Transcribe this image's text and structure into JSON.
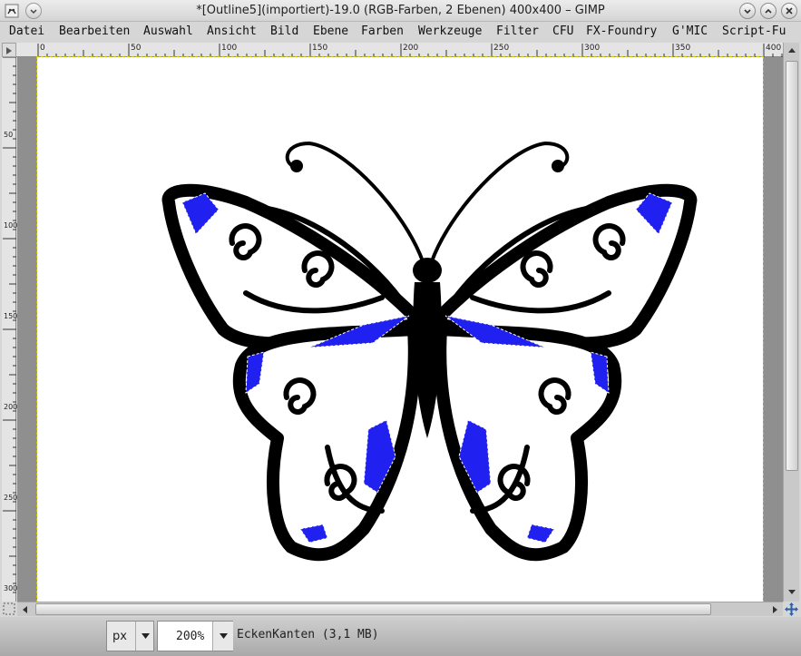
{
  "window": {
    "title": "*[Outline5](importiert)-19.0 (RGB-Farben, 2 Ebenen) 400x400 – GIMP"
  },
  "menubar": {
    "items": [
      {
        "label": "Datei"
      },
      {
        "label": "Bearbeiten"
      },
      {
        "label": "Auswahl"
      },
      {
        "label": "Ansicht"
      },
      {
        "label": "Bild"
      },
      {
        "label": "Ebene"
      },
      {
        "label": "Farben"
      },
      {
        "label": "Werkzeuge"
      },
      {
        "label": "Filter"
      },
      {
        "label": "CFU"
      },
      {
        "label": "FX-Foundry"
      },
      {
        "label": "G'MIC"
      },
      {
        "label": "Script-Fu"
      }
    ]
  },
  "rulers": {
    "horizontal_labels": [
      "0",
      "50",
      "100",
      "150",
      "200",
      "250",
      "300",
      "350",
      "400"
    ],
    "vertical_labels": [
      "50",
      "100",
      "150",
      "200",
      "250",
      "300"
    ]
  },
  "statusbar": {
    "unit": "px",
    "zoom": "200%",
    "message": "EckenKanten (3,1 MB)"
  },
  "colors": {
    "selection_fill": "#2020f0",
    "ink": "#000000",
    "canvas_bg": "#ffffff",
    "window_bg": "#d6d6d6"
  },
  "icons": {
    "app": "gimp-wilber-icon",
    "ruler_corner": "play-icon",
    "quick_mask": "quick-mask-icon",
    "navigate": "navigate-icon"
  }
}
